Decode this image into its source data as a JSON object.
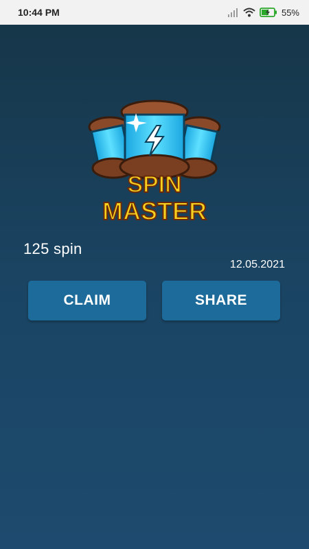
{
  "status_bar": {
    "time": "10:44 PM",
    "battery_percent": "55%",
    "icons": [
      "signal-icon",
      "wifi-icon",
      "battery-charging-icon"
    ]
  },
  "logo": {
    "line1": "SPIN",
    "line2": "MASTER"
  },
  "reward": {
    "spin_count": "125 spin",
    "date": "12.05.2021"
  },
  "buttons": {
    "claim_label": "CLAIM",
    "share_label": "SHARE"
  },
  "colors": {
    "background_top": "#163547",
    "background_bottom": "#1d4a6e",
    "button": "#1d6b9a",
    "logo_text": "#f7d11e",
    "logo_brown": "#8a4a2a",
    "logo_cyan": "#35c6f0"
  }
}
